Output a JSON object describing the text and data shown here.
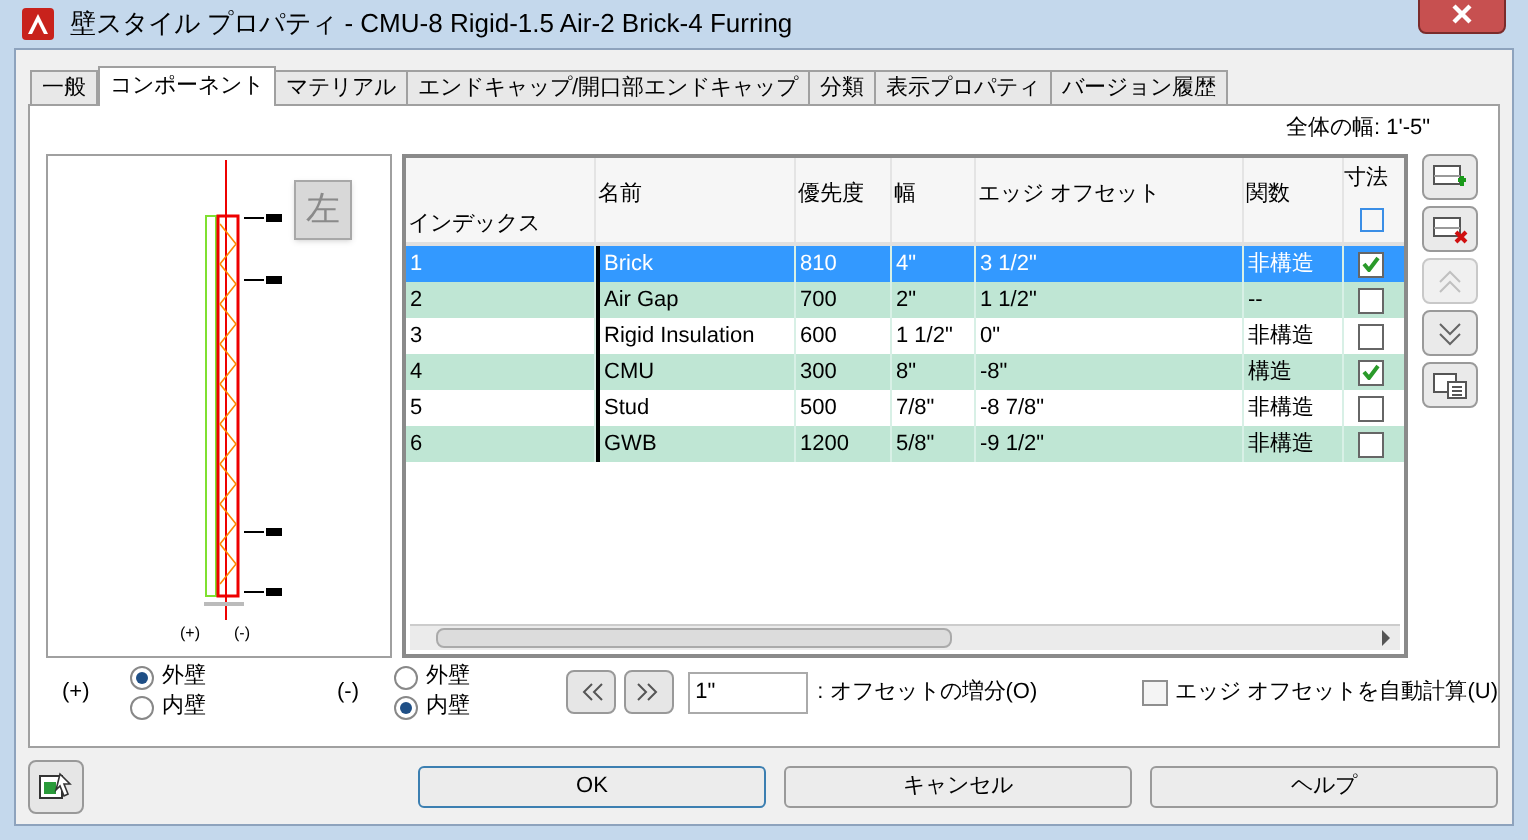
{
  "window": {
    "title": "壁スタイル プロパティ - CMU-8 Rigid-1.5 Air-2 Brick-4 Furring"
  },
  "tabs": [
    {
      "label": "一般",
      "selected": false
    },
    {
      "label": "コンポーネント",
      "selected": true
    },
    {
      "label": "マテリアル",
      "selected": false
    },
    {
      "label": "エンドキャップ/開口部エンドキャップ",
      "selected": false
    },
    {
      "label": "分類",
      "selected": false
    },
    {
      "label": "表示プロパティ",
      "selected": false
    },
    {
      "label": "バージョン履歴",
      "selected": false
    }
  ],
  "total_width": "全体の幅: 1'-5\"",
  "preview": {
    "side_button": "左",
    "plus_mark": "(+)",
    "minus_mark": "(-)"
  },
  "table": {
    "columns": [
      "インデックス",
      "名前",
      "優先度",
      "幅",
      "エッジ オフセット",
      "関数",
      "寸法"
    ],
    "rows": [
      {
        "index": "1",
        "name": "Brick",
        "priority": "810",
        "width": "4\"",
        "edge_offset": "3 1/2\"",
        "function": "非構造",
        "dimension": true,
        "selected": true
      },
      {
        "index": "2",
        "name": "Air Gap",
        "priority": "700",
        "width": "2\"",
        "edge_offset": "1 1/2\"",
        "function": "--",
        "dimension": false,
        "selected": false
      },
      {
        "index": "3",
        "name": "Rigid Insulation",
        "priority": "600",
        "width": "1 1/2\"",
        "edge_offset": "0\"",
        "function": "非構造",
        "dimension": false,
        "selected": false
      },
      {
        "index": "4",
        "name": "CMU",
        "priority": "300",
        "width": "8\"",
        "edge_offset": "-8\"",
        "function": "構造",
        "dimension": true,
        "selected": false
      },
      {
        "index": "5",
        "name": "Stud",
        "priority": "500",
        "width": "7/8\"",
        "edge_offset": "-8 7/8\"",
        "function": "非構造",
        "dimension": false,
        "selected": false
      },
      {
        "index": "6",
        "name": "GWB",
        "priority": "1200",
        "width": "5/8\"",
        "edge_offset": "-9 1/2\"",
        "function": "非構造",
        "dimension": false,
        "selected": false
      }
    ]
  },
  "plus_side": {
    "label": "(+)",
    "options": [
      {
        "label": "外壁",
        "selected": true
      },
      {
        "label": "内壁",
        "selected": false
      }
    ]
  },
  "minus_side": {
    "label": "(-)",
    "options": [
      {
        "label": "外壁",
        "selected": false
      },
      {
        "label": "内壁",
        "selected": true
      }
    ]
  },
  "offset_increment": {
    "value": "1\"",
    "label": ": オフセットの増分(O)"
  },
  "auto_offset": {
    "label": "エッジ オフセットを自動計算(U)",
    "checked": false
  },
  "buttons": [
    "OK",
    "キャンセル",
    "ヘルプ"
  ]
}
